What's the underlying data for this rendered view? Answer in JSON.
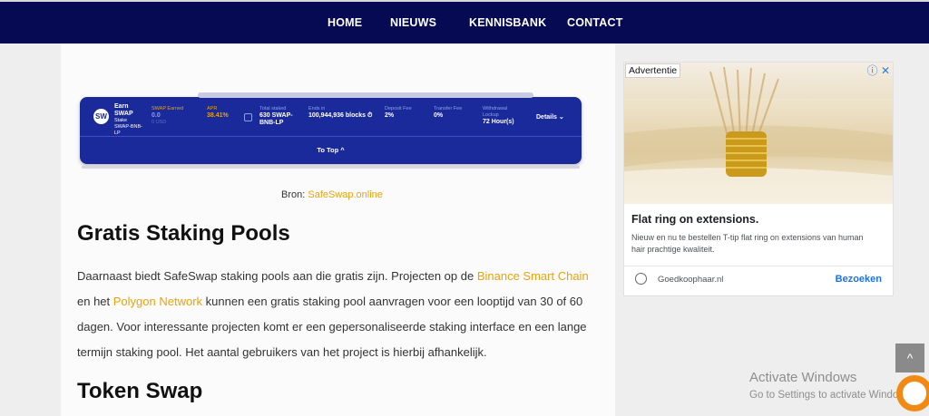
{
  "nav": {
    "items": [
      {
        "label": "HOME"
      },
      {
        "label": "NIEUWS"
      },
      {
        "label": "KENNISBANK"
      },
      {
        "label": "CONTACT"
      }
    ]
  },
  "widget": {
    "logo": "SW",
    "earn_line1": "Earn",
    "earn_line2": "SWAP",
    "stake_line1": "Stake",
    "stake_line2": "SWAP-BNB-",
    "stake_line3": "LP",
    "swap_earned_label": "SWAP Earned",
    "swap_earned_value": "0.0",
    "swap_earned_sub": "0 USD",
    "apr_label": "APR",
    "apr_value": "38.41%",
    "total_staked_label": "Total staked",
    "total_staked_value1": "630 SWAP-",
    "total_staked_value2": "BNB-LP",
    "ends_label": "Ends in",
    "ends_value": "100,944,936 blocks ⏱",
    "deposit_label": "Deposit Fee",
    "deposit_value": "2%",
    "transfer_label": "Transfer Fee",
    "transfer_value": "0%",
    "withdrawal_label1": "Withdrawal",
    "withdrawal_label2": "Lockup",
    "withdrawal_value": "72 Hour(s)",
    "details": "Details ⌄",
    "to_top": "To Top ^"
  },
  "source": {
    "prefix": "Bron: ",
    "link": "SafeSwap.online"
  },
  "heading1": "Gratis Staking Pools",
  "paragraph": {
    "t1": "Daarnaast biedt SafeSwap staking pools aan die gratis zijn. Projecten op de ",
    "link1": "Binance Smart Chain",
    "t2": " en het ",
    "link2": "Polygon Network",
    "t3": " kunnen een gratis staking pool aanvragen voor een looptijd van 30 of 60 dagen. Voor interessante projecten komt er een gepersonaliseerde staking interface en een lange termijn staking pool. Het aantal gebruikers van het project is hierbij afhankelijk."
  },
  "heading2": "Token Swap",
  "ad": {
    "badge": "Advertentie",
    "controls": "ⓘ ✕",
    "title": "Flat ring on extensions.",
    "description": "Nieuw en nu te bestellen T-tip flat ring on extensions van human hair prachtige kwaliteit.",
    "domain": "Goedkoophaar.nl",
    "cta": "Bezoeken"
  },
  "scroll_top": "^",
  "watermark": {
    "line1": "Activate Windows",
    "line2": "Go to Settings to activate Windows."
  },
  "colors": {
    "nav_bg": "#050a52",
    "link": "#e8a30f",
    "widget_bg": "#1a2a9b",
    "ad_cta": "#1a73e8",
    "bell": "#f08a14"
  }
}
